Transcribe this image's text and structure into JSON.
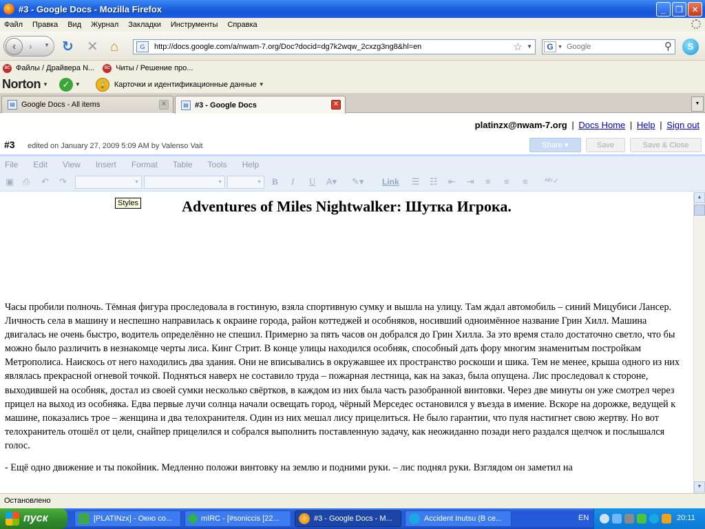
{
  "window": {
    "title": "#3 - Google Docs - Mozilla Firefox",
    "minimize": "_",
    "maximize": "❐",
    "close": "✕"
  },
  "menu": {
    "items": [
      "Файл",
      "Правка",
      "Вид",
      "Журнал",
      "Закладки",
      "Инструменты",
      "Справка"
    ]
  },
  "navigation": {
    "url": "http://docs.google.com/a/nwam-7.org/Doc?docid=dg7k2wqw_2cxzg3ng8&hl=en",
    "search_placeholder": "Google"
  },
  "bookmarks": {
    "items": [
      "Файлы / Драйвера N...",
      "Читы / Решение про..."
    ]
  },
  "norton": {
    "logo": "Norton",
    "identity_label": "Карточки и идентификационные данные"
  },
  "tabs": [
    {
      "label": "Google Docs - All items",
      "active": false
    },
    {
      "label": "#3 - Google Docs",
      "active": true
    }
  ],
  "docs_header": {
    "user": "platinzx@nwam-7.org",
    "sep": "|",
    "links": [
      "Docs Home",
      "Help",
      "Sign out"
    ],
    "doc_number": "#3",
    "edited_info": "edited on January 27, 2009 5:09 AM by Valenso Vait",
    "buttons": {
      "share": "Share ▾",
      "save": "Save",
      "save_close": "Save & Close"
    }
  },
  "docs_menu": {
    "items": [
      "File",
      "Edit",
      "View",
      "Insert",
      "Format",
      "Table",
      "Tools",
      "Help"
    ]
  },
  "toolbar": {
    "bold": "B",
    "italic": "I",
    "underline": "U",
    "link": "Link"
  },
  "document": {
    "tooltip": "Styles",
    "title": "Adventures of Miles Nightwalker: Шутка Игрока.",
    "paragraphs": [
      "Часы пробили полночь. Тёмная фигура проследовала в гостиную, взяла спортивную сумку и вышла на улицу. Там ждал автомобиль – синий Мицубиси Лансер. Личность села в машину и неспешно направилась к окраине города, район коттеджей и особняков, носивший одноимённое название Грин Хилл. Машина двигалась не очень быстро, водитель определённо не спешил. Примерно за пять часов он добрался до Грин Хилла. За это время стало достаточно светло, что бы можно было различить в незнакомце черты лиса. Кинг Стрит. В конце улицы находился особняк, способный дать фору многим знаменитым постройкам Метрополиса. Наискось от него находились два здания. Они не вписывались в окружавшее их пространство роскоши и шика. Тем не менее, крыша одного из них являлась прекрасной огневой точкой. Подняться наверх не составило труда – пожарная лестница, как на заказ, была опущена. Лис проследовал к стороне, выходившей на особняк, достал из своей сумки несколько свёртков, в каждом из них была часть разобранной винтовки. Через две минуты он уже смотрел через прицел на выход из особняка. Едва первые лучи солнца начали освещать город, чёрный Мерседес остановился у въезда в имение. Вскоре на дорожке, ведущей к машине, показались трое – женщина и два телохранителя. Один из них мешал лису прицелиться. Не было гарантии, что пуля настигнет свою жертву. Но вот телохранитель отошёл от цели, снайпер прицелился и собрался выполнить поставленную задачу, как неожиданно позади него раздался щелчок и послышался голос.",
      "- Ещё одно движение и ты покойник. Медленно положи винтовку на землю и подними руки. – лис поднял руки. Взглядом он заметил на"
    ]
  },
  "status": {
    "text": "Остановлено"
  },
  "taskbar": {
    "start": "пуск",
    "tasks": [
      {
        "label": "[PLATINzx] - Окно со...",
        "active": false
      },
      {
        "label": "mIRC - [#soniccis [22...",
        "active": false
      },
      {
        "label": "#3 - Google Docs - M...",
        "active": true
      },
      {
        "label": "Accident Inutsu (В се...",
        "active": false
      }
    ],
    "lang": "EN",
    "clock": "20:11"
  }
}
